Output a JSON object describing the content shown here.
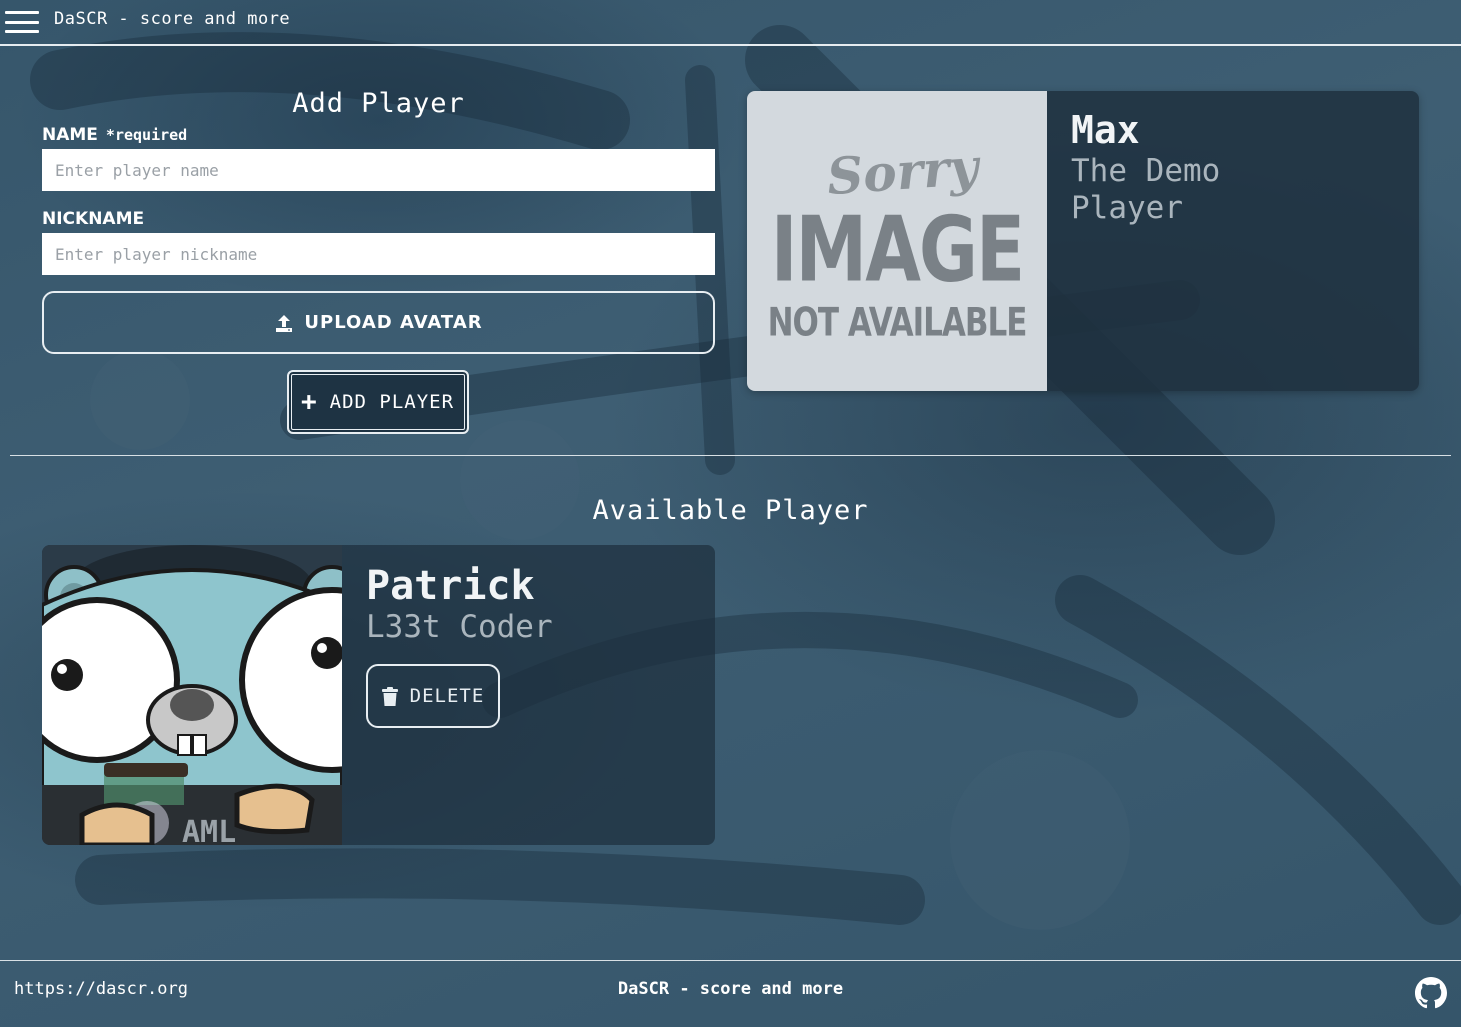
{
  "header": {
    "title": "DaSCR - score and more",
    "menu_icon": "hamburger-menu-icon"
  },
  "add_player": {
    "title": "Add Player",
    "name_label": "NAME",
    "required_label": "*required",
    "name_placeholder": "Enter player name",
    "nickname_label": "NICKNAME",
    "nickname_placeholder": "Enter player nickname",
    "upload_label": "UPLOAD AVATAR",
    "upload_icon": "upload-icon",
    "add_label": "ADD PLAYER",
    "add_icon": "plus-icon"
  },
  "preview": {
    "name": "Max",
    "nickname": "The Demo Player",
    "image_text": {
      "sorry": "Sorry",
      "image": "IMAGE",
      "not_available": "NOT AVAILABLE"
    }
  },
  "available": {
    "title": "Available Player",
    "players": [
      {
        "name": "Patrick",
        "nickname": "L33t Coder",
        "delete_label": "DELETE",
        "delete_icon": "trash-icon",
        "avatar": "gopher-avatar"
      }
    ]
  },
  "footer": {
    "link": "https://dascr.org",
    "title": "DaSCR - score and more",
    "github_icon": "github-icon"
  },
  "colors": {
    "background": "#3b5b70",
    "card": "#1e303e",
    "text": "#ffffff",
    "muted_text": "#aab5bd"
  }
}
